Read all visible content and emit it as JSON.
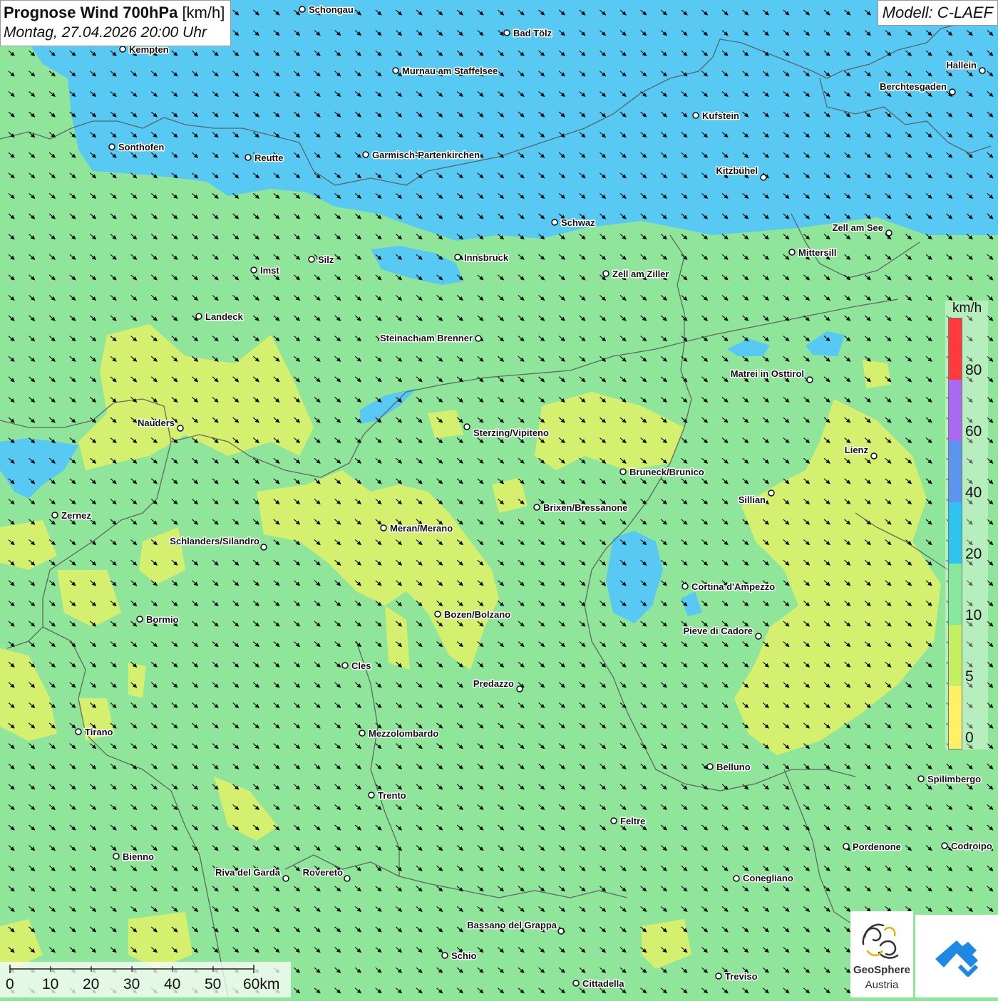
{
  "header": {
    "title_bold": "Prognose Wind 700hPa",
    "title_unit": "[km/h]",
    "datetime": "Montag, 27.04.2026 20:00 Uhr"
  },
  "model": {
    "label": "Modell: C-LAEF"
  },
  "legend": {
    "unit": "km/h",
    "ticks": [
      "80",
      "60",
      "40",
      "20",
      "10",
      "5",
      "0"
    ],
    "colors": [
      "#ff3a3a",
      "#a86af0",
      "#5a96ef",
      "#2fc3f0",
      "#86e89a",
      "#c4f060",
      "#fff066"
    ]
  },
  "scale": {
    "labels": [
      "0",
      "10",
      "20",
      "30",
      "40",
      "50",
      "60km"
    ]
  },
  "logos": {
    "geosphere_line1": "GeoSphere",
    "geosphere_line2": "Austria"
  },
  "colors": {
    "calm_green": "#8fe59a",
    "blue_20kmh": "#58c9f2",
    "yellow_5kmh": "#d9f06c",
    "arrow": "#111111",
    "border": "#555555"
  },
  "wind": {
    "direction_description": "from northwest"
  },
  "cities": [
    {
      "name": "Schongau"
    },
    {
      "name": "Bad Tölz"
    },
    {
      "name": "Kempten"
    },
    {
      "name": "Murnau am Staffelsee"
    },
    {
      "name": "Hallein"
    },
    {
      "name": "Berchtesgaden"
    },
    {
      "name": "Kufstein"
    },
    {
      "name": "Sonthofen"
    },
    {
      "name": "Reutte"
    },
    {
      "name": "Garmisch-Partenkirchen"
    },
    {
      "name": "Kitzbühel"
    },
    {
      "name": "Schwaz"
    },
    {
      "name": "Zell am See"
    },
    {
      "name": "Innsbruck"
    },
    {
      "name": "Mittersill"
    },
    {
      "name": "Silz"
    },
    {
      "name": "Imst"
    },
    {
      "name": "Zell am Ziller"
    },
    {
      "name": "Landeck"
    },
    {
      "name": "Steinach am Brenner"
    },
    {
      "name": "Matrei in Osttirol"
    },
    {
      "name": "Nauders"
    },
    {
      "name": "Sterzing/Vipiteno"
    },
    {
      "name": "Lienz"
    },
    {
      "name": "Bruneck/Brunico"
    },
    {
      "name": "Sillian"
    },
    {
      "name": "Zernez"
    },
    {
      "name": "Brixen/Bressanone"
    },
    {
      "name": "Meran/Merano"
    },
    {
      "name": "Schlanders/Silandro"
    },
    {
      "name": "Cortina d'Ampezzo"
    },
    {
      "name": "Bozen/Bolzano"
    },
    {
      "name": "Bormio"
    },
    {
      "name": "Pieve di Cadore"
    },
    {
      "name": "Cles"
    },
    {
      "name": "Predazzo"
    },
    {
      "name": "Tirano"
    },
    {
      "name": "Mezzolombardo"
    },
    {
      "name": "Belluno"
    },
    {
      "name": "Spilimbergo"
    },
    {
      "name": "Trento"
    },
    {
      "name": "Feltre"
    },
    {
      "name": "Pordenone"
    },
    {
      "name": "Codroipo"
    },
    {
      "name": "Bienno"
    },
    {
      "name": "Riva del Garda"
    },
    {
      "name": "Rovereto"
    },
    {
      "name": "Conegliano"
    },
    {
      "name": "Bassano del Grappa"
    },
    {
      "name": "Schio"
    },
    {
      "name": "Treviso"
    },
    {
      "name": "Cittadella"
    }
  ]
}
